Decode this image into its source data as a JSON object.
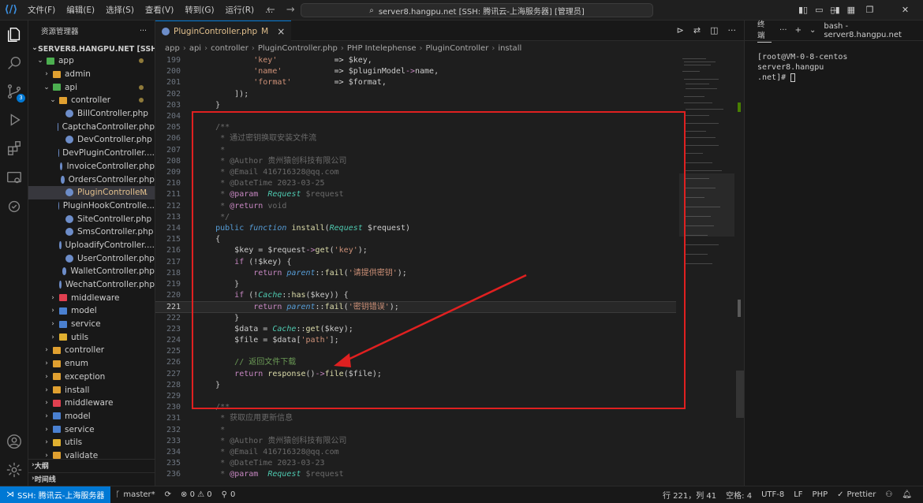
{
  "titlebar": {
    "menu": [
      "文件(F)",
      "编辑(E)",
      "选择(S)",
      "查看(V)",
      "转到(G)",
      "运行(R)",
      "..."
    ],
    "search_text": "server8.hangpu.net [SSH: 腾讯云-上海服务器] [管理员]"
  },
  "activity": {
    "scm_badge": "3"
  },
  "explorer": {
    "header": "资源管理器",
    "more": "···",
    "root": "SERVER8.HANGPU.NET [SSH: 腾讯...",
    "items": [
      {
        "label": "app",
        "type": "folder",
        "depth": 1,
        "open": true,
        "dot": true,
        "color": "#4caf50"
      },
      {
        "label": "admin",
        "type": "folder",
        "depth": 2,
        "open": false,
        "dot": false,
        "color": "#e0a030"
      },
      {
        "label": "api",
        "type": "folder",
        "depth": 2,
        "open": true,
        "dot": true,
        "color": "#4caf50"
      },
      {
        "label": "controller",
        "type": "folder",
        "depth": 3,
        "open": true,
        "dot": true,
        "color": "#e0a030"
      },
      {
        "label": "BillController.php",
        "type": "file",
        "depth": 4
      },
      {
        "label": "CaptchaController.php",
        "type": "file",
        "depth": 4
      },
      {
        "label": "DevController.php",
        "type": "file",
        "depth": 4
      },
      {
        "label": "DevPluginController....",
        "type": "file",
        "depth": 4
      },
      {
        "label": "InvoiceController.php",
        "type": "file",
        "depth": 4
      },
      {
        "label": "OrdersController.php",
        "type": "file",
        "depth": 4
      },
      {
        "label": "PluginControlle...",
        "type": "file",
        "depth": 4,
        "selected": true,
        "modified": "M"
      },
      {
        "label": "PluginHookControlle...",
        "type": "file",
        "depth": 4
      },
      {
        "label": "SiteController.php",
        "type": "file",
        "depth": 4
      },
      {
        "label": "SmsController.php",
        "type": "file",
        "depth": 4
      },
      {
        "label": "UploadifyController....",
        "type": "file",
        "depth": 4
      },
      {
        "label": "UserController.php",
        "type": "file",
        "depth": 4
      },
      {
        "label": "WalletController.php",
        "type": "file",
        "depth": 4
      },
      {
        "label": "WechatController.php",
        "type": "file",
        "depth": 4
      },
      {
        "label": "middleware",
        "type": "folder",
        "depth": 3,
        "open": false,
        "color": "#e04050"
      },
      {
        "label": "model",
        "type": "folder",
        "depth": 3,
        "open": false,
        "color": "#4a80d0"
      },
      {
        "label": "service",
        "type": "folder",
        "depth": 3,
        "open": false,
        "color": "#4a80d0"
      },
      {
        "label": "utils",
        "type": "folder",
        "depth": 3,
        "open": false,
        "color": "#e0b030"
      },
      {
        "label": "controller",
        "type": "folder",
        "depth": 2,
        "open": false,
        "color": "#e0a030"
      },
      {
        "label": "enum",
        "type": "folder",
        "depth": 2,
        "open": false,
        "color": "#e0a030"
      },
      {
        "label": "exception",
        "type": "folder",
        "depth": 2,
        "open": false,
        "color": "#e0a030"
      },
      {
        "label": "install",
        "type": "folder",
        "depth": 2,
        "open": false,
        "color": "#e0a030"
      },
      {
        "label": "middleware",
        "type": "folder",
        "depth": 2,
        "open": false,
        "color": "#e04050"
      },
      {
        "label": "model",
        "type": "folder",
        "depth": 2,
        "open": false,
        "color": "#4a80d0"
      },
      {
        "label": "service",
        "type": "folder",
        "depth": 2,
        "open": false,
        "color": "#4a80d0"
      },
      {
        "label": "utils",
        "type": "folder",
        "depth": 2,
        "open": false,
        "color": "#e0b030"
      },
      {
        "label": "validate",
        "type": "folder",
        "depth": 2,
        "open": false,
        "color": "#e0a030"
      }
    ],
    "outline": "大纲",
    "timeline": "时间线"
  },
  "editor": {
    "tab_label": "PluginController.php",
    "tab_flag": "M",
    "tab_close": "×",
    "breadcrumb": [
      "app",
      "api",
      "controller",
      "PluginController.php",
      "PHP Intelephense",
      "PluginController",
      "install"
    ],
    "current_line": 221,
    "lines": [
      {
        "n": 199,
        "html": "            <span class=\"c-str\">'key'</span>            <span class=\"c-op\">=&gt;</span> <span class=\"c-var\">$key</span>,"
      },
      {
        "n": 200,
        "html": "            <span class=\"c-str\">'name'</span>           <span class=\"c-op\">=&gt;</span> <span class=\"c-var\">$pluginModel</span><span class=\"c-arrow\">-&gt;</span><span class=\"c-var\">name</span>,"
      },
      {
        "n": 201,
        "html": "            <span class=\"c-str\">'format'</span>         <span class=\"c-op\">=&gt;</span> <span class=\"c-var\">$format</span>,"
      },
      {
        "n": 202,
        "html": "        ]);"
      },
      {
        "n": 203,
        "html": "    }"
      },
      {
        "n": 204,
        "html": ""
      },
      {
        "n": 205,
        "html": "    <span class=\"c-cm2\">/**</span>"
      },
      {
        "n": 206,
        "html": "     <span class=\"c-cm2\">* 通过密钥换取安装文件流</span>"
      },
      {
        "n": 207,
        "html": "     <span class=\"c-cm2\">*</span>"
      },
      {
        "n": 208,
        "html": "     <span class=\"c-cm2\">* @Author 贵州猿创科技有限公司</span>"
      },
      {
        "n": 209,
        "html": "     <span class=\"c-cm2\">* @Email 416716328@qq.com</span>"
      },
      {
        "n": 210,
        "html": "     <span class=\"c-cm2\">* @DateTime 2023-03-25</span>"
      },
      {
        "n": 211,
        "html": "     <span class=\"c-cm2\">*</span> <span class=\"c-tag\">@param</span>  <span class=\"c-type\">Request</span> <span class=\"c-cm2\">$request</span>"
      },
      {
        "n": 212,
        "html": "     <span class=\"c-cm2\">*</span> <span class=\"c-tag\">@return</span> <span class=\"c-cm2\">void</span>"
      },
      {
        "n": 213,
        "html": "     <span class=\"c-cm2\">*/</span>"
      },
      {
        "n": 214,
        "html": "    <span class=\"c-kw\">public</span> <span class=\"c-kwi\">function</span> <span class=\"c-fn\">install</span>(<span class=\"c-type\">Request</span> <span class=\"c-var\">$request</span>)"
      },
      {
        "n": 215,
        "html": "    {"
      },
      {
        "n": 216,
        "html": "        <span class=\"c-var\">$key</span> = <span class=\"c-var\">$request</span><span class=\"c-arrow\">-&gt;</span><span class=\"c-fn\">get</span>(<span class=\"c-str\">'key'</span>);"
      },
      {
        "n": 217,
        "html": "        <span class=\"c-ctl\">if</span> (!<span class=\"c-var\">$key</span>) {"
      },
      {
        "n": 218,
        "html": "            <span class=\"c-ctl\">return</span> <span class=\"c-kwi\">parent</span><span class=\"c-op\">::</span><span class=\"c-fn\">fail</span>(<span class=\"c-str\">'请提供密钥'</span>);"
      },
      {
        "n": 219,
        "html": "        }"
      },
      {
        "n": 220,
        "html": "        <span class=\"c-ctl\">if</span> (!<span class=\"c-type\">Cache</span><span class=\"c-op\">::</span><span class=\"c-fn\">has</span>(<span class=\"c-var\">$key</span>)) {"
      },
      {
        "n": 221,
        "html": "            <span class=\"c-ctl\">return</span> <span class=\"c-kwi\">parent</span><span class=\"c-op\">::</span><span class=\"c-fn\">fail</span>(<span class=\"c-str\">'密钥错误'</span>);"
      },
      {
        "n": 222,
        "html": "        }"
      },
      {
        "n": 223,
        "html": "        <span class=\"c-var\">$data</span> = <span class=\"c-type\">Cache</span><span class=\"c-op\">::</span><span class=\"c-fn\">get</span>(<span class=\"c-var\">$key</span>);"
      },
      {
        "n": 224,
        "html": "        <span class=\"c-var\">$file</span> = <span class=\"c-var\">$data</span>[<span class=\"c-str\">'path'</span>];"
      },
      {
        "n": 225,
        "html": ""
      },
      {
        "n": 226,
        "html": "        <span class=\"c-cm\">// 返回文件下载</span>"
      },
      {
        "n": 227,
        "html": "        <span class=\"c-ctl\">return</span> <span class=\"c-fn\">response</span>()<span class=\"c-arrow\">-&gt;</span><span class=\"c-fn\">file</span>(<span class=\"c-var\">$file</span>);"
      },
      {
        "n": 228,
        "html": "    }"
      },
      {
        "n": 229,
        "html": ""
      },
      {
        "n": 230,
        "html": "    <span class=\"c-cm2\">/**</span>"
      },
      {
        "n": 231,
        "html": "     <span class=\"c-cm2\">* 获取应用更新信息</span>"
      },
      {
        "n": 232,
        "html": "     <span class=\"c-cm2\">*</span>"
      },
      {
        "n": 233,
        "html": "     <span class=\"c-cm2\">* @Author 贵州猿创科技有限公司</span>"
      },
      {
        "n": 234,
        "html": "     <span class=\"c-cm2\">* @Email 416716328@qq.com</span>"
      },
      {
        "n": 235,
        "html": "     <span class=\"c-cm2\">* @DateTime 2023-03-23</span>"
      },
      {
        "n": 236,
        "html": "     <span class=\"c-cm2\">*</span> <span class=\"c-tag\">@param</span>  <span class=\"c-type\">Request</span> <span class=\"c-cm2\">$request</span>"
      }
    ]
  },
  "terminal": {
    "tab": "终端",
    "more": "···",
    "add": "+",
    "shell": "bash - server8.hangpu.net",
    "line1": "[root@VM-0-8-centos server8.hangpu",
    "line2": ".net]# "
  },
  "statusbar": {
    "remote": "SSH: 腾讯云-上海服务器",
    "branch": "master*",
    "problems": "⊗ 0 ⚠ 0",
    "ports": "0",
    "position": "行 221，列 41",
    "spaces": "空格: 4",
    "encoding": "UTF-8",
    "eol": "LF",
    "language": "PHP",
    "prettier": "Prettier"
  }
}
